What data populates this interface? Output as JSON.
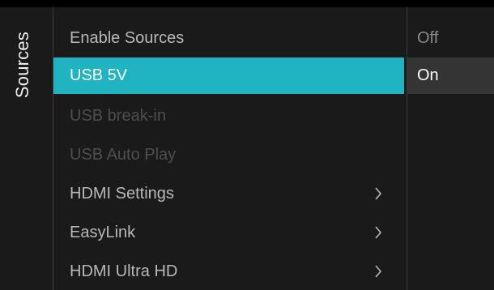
{
  "sidebar": {
    "title": "Sources"
  },
  "menu": {
    "items": [
      {
        "label": "Enable Sources",
        "state": "normal",
        "submenu": false
      },
      {
        "label": "USB 5V",
        "state": "selected",
        "submenu": false
      },
      {
        "label": "USB break-in",
        "state": "disabled",
        "submenu": false
      },
      {
        "label": "USB Auto Play",
        "state": "disabled",
        "submenu": false
      },
      {
        "label": "HDMI Settings",
        "state": "normal",
        "submenu": true
      },
      {
        "label": "EasyLink",
        "state": "normal",
        "submenu": true
      },
      {
        "label": "HDMI Ultra HD",
        "state": "normal",
        "submenu": true
      }
    ]
  },
  "options": {
    "items": [
      {
        "label": "Off",
        "selected": false
      },
      {
        "label": "On",
        "selected": true
      }
    ]
  },
  "colors": {
    "accent": "#20b3c2",
    "background": "#1a1a1a",
    "option_highlight": "#343434"
  },
  "icons": {
    "submenu": "chevron-right-icon"
  }
}
